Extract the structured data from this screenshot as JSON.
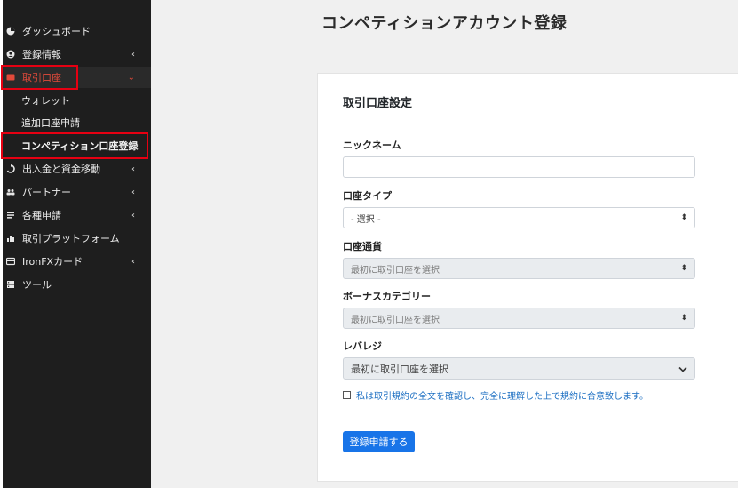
{
  "sidebar": {
    "items": [
      {
        "label": "ダッシュボード",
        "icon": "dashboard-pie-icon",
        "chevron": ""
      },
      {
        "label": "登録情報",
        "icon": "user-circle-icon",
        "chevron": "‹"
      },
      {
        "label": "取引口座",
        "icon": "account-card-icon",
        "chevron": "⌄"
      },
      {
        "label": "出入金と資金移動",
        "icon": "transfer-icon",
        "chevron": "‹"
      },
      {
        "label": "パートナー",
        "icon": "partners-icon",
        "chevron": "‹"
      },
      {
        "label": "各種申請",
        "icon": "list-icon",
        "chevron": "‹"
      },
      {
        "label": "取引プラットフォーム",
        "icon": "bar-chart-icon",
        "chevron": ""
      },
      {
        "label": "IronFXカード",
        "icon": "credit-card-icon",
        "chevron": "‹"
      },
      {
        "label": "ツール",
        "icon": "tools-icon",
        "chevron": ""
      }
    ],
    "sub_items": [
      {
        "label": "ウォレット"
      },
      {
        "label": "追加口座申請"
      },
      {
        "label": "コンペティション口座登録"
      }
    ],
    "active_color": "#e24a3a",
    "highlight_color": "#e60012"
  },
  "page": {
    "title": "コンペティションアカウント登録"
  },
  "form": {
    "title": "取引口座設定",
    "nickname_label": "ニックネーム",
    "nickname_value": "",
    "account_type_label": "口座タイプ",
    "account_type_value": "- 選択 -",
    "currency_label": "口座通貨",
    "currency_value": "最初に取引口座を選択",
    "bonus_label": "ボーナスカテゴリー",
    "bonus_value": "最初に取引口座を選択",
    "leverage_label": "レバレジ",
    "leverage_value": "最初に取引口座を選択",
    "agree_text": "私は取引規約の全文を確認し、完全に理解した上で規約に合意致します。",
    "submit_label": "登録申請する",
    "submit_color": "#1874e8"
  }
}
